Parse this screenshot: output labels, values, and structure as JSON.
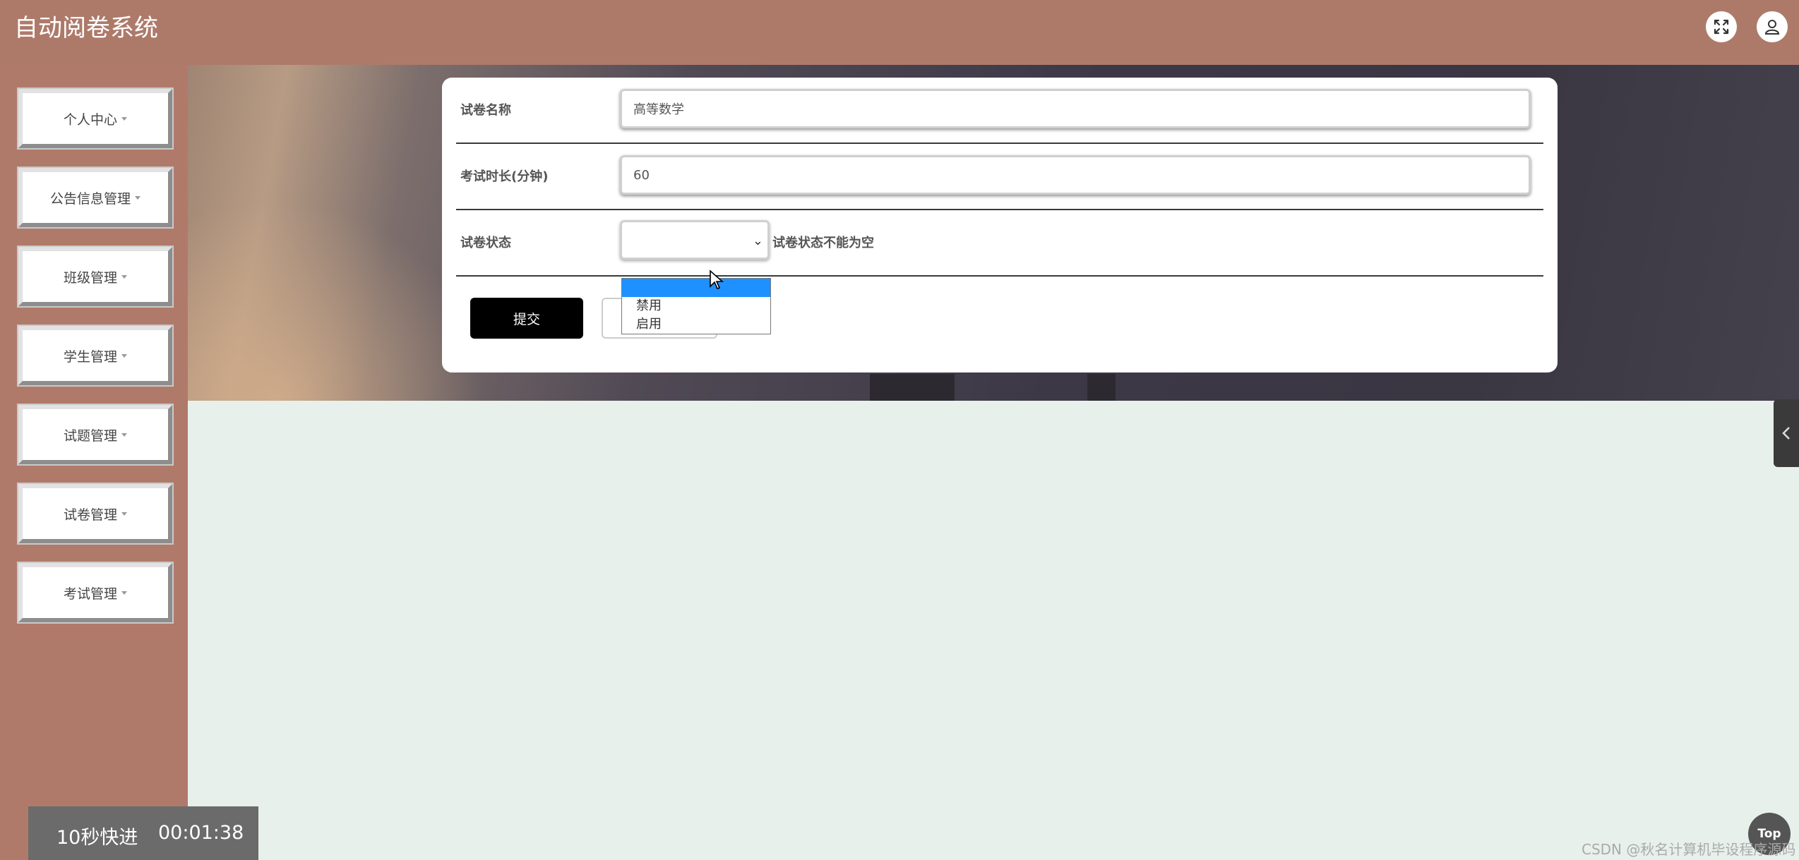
{
  "header": {
    "title": "自动阅卷系统",
    "icons": [
      "fullscreen-icon",
      "user-icon"
    ]
  },
  "sidebar": {
    "items": [
      {
        "label": "个人中心"
      },
      {
        "label": "公告信息管理"
      },
      {
        "label": "班级管理"
      },
      {
        "label": "学生管理"
      },
      {
        "label": "试题管理"
      },
      {
        "label": "试卷管理"
      },
      {
        "label": "考试管理"
      }
    ]
  },
  "form": {
    "name_label": "试卷名称",
    "name_value": "高等数学",
    "duration_label": "考试时长(分钟)",
    "duration_value": "60",
    "status_label": "试卷状态",
    "status_error": "试卷状态不能为空",
    "status_options": [
      "禁用",
      "启用"
    ],
    "submit_label": "提交"
  },
  "timer": {
    "label": "10秒快进",
    "time": "00:01:38"
  },
  "top_button": "Top",
  "watermark": "CSDN @秋名计算机毕设程序源码",
  "colors": {
    "header": "#ad7a6a",
    "sidebar": "#b07a6b",
    "content_bg": "#e7f0eb",
    "highlight": "#1e90ff"
  }
}
